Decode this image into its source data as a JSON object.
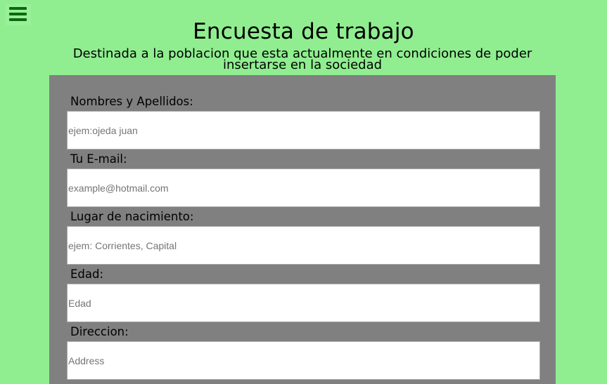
{
  "header": {
    "menu_icon": "hamburger-menu-icon",
    "title": "Encuesta de trabajo",
    "subtitle": "Destinada a la poblacion que esta actualmente en condiciones de poder insertarse en la sociedad"
  },
  "form": {
    "fields": [
      {
        "label": "Nombres y Apellidos:",
        "placeholder": "ejem:ojeda juan",
        "value": ""
      },
      {
        "label": "Tu E-mail:",
        "placeholder": "example@hotmail.com",
        "value": ""
      },
      {
        "label": "Lugar de nacimiento:",
        "placeholder": "ejem: Corrientes, Capital",
        "value": ""
      },
      {
        "label": "Edad:",
        "placeholder": "Edad",
        "value": ""
      },
      {
        "label": "Direccion:",
        "placeholder": "Address",
        "value": ""
      }
    ]
  },
  "colors": {
    "page_background": "#90ee90",
    "form_background": "#808080",
    "menu_icon": "#0a6b0a",
    "input_background": "#ffffff"
  }
}
